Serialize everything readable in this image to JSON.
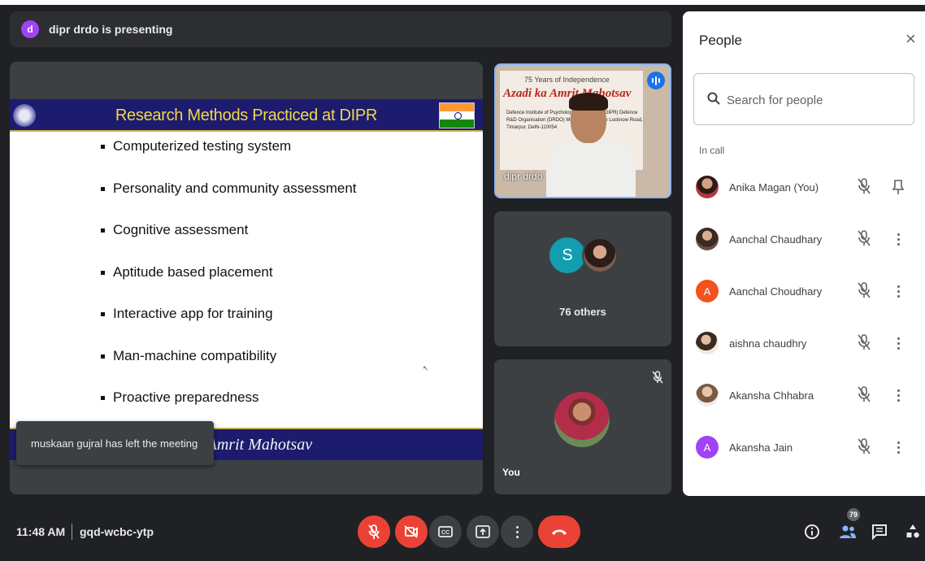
{
  "presenting": {
    "avatar_letter": "d",
    "text": "dipr drdo is presenting"
  },
  "slide": {
    "title": "Research Methods Practiced at DIPR",
    "bullets": [
      "Computerized testing system",
      "Personality and community assessment",
      "Cognitive assessment",
      "Aptitude based placement",
      "Interactive app for training",
      "Man-machine compatibility",
      "Proactive preparedness"
    ],
    "footer_text": "a Amrit Mahotsav"
  },
  "toast": {
    "text": "muskaan gujral has left the meeting"
  },
  "tiles": {
    "presenter": {
      "name": "dipr drdo",
      "banner_top": "75 Years of Independence",
      "banner_main": "Azadi ka Amrit Mahotsav",
      "banner_small": "Defence Institute of Psychological Research (DIPR) Defence R&D Organisation (DRDO) Ministry of Defence Lucknow Road, Timarpur, Delhi-110054"
    },
    "others": {
      "avatar_letter": "S",
      "label": "76 others"
    },
    "you": {
      "label": "You"
    }
  },
  "panel": {
    "title": "People",
    "search_placeholder": "Search for people",
    "section_label": "In call",
    "participants": [
      {
        "name": "Anika Magan (You)",
        "avatar": "photo",
        "color": "#b03848",
        "action": "pin"
      },
      {
        "name": "Aanchal Chaudhary",
        "avatar": "photo",
        "color": "#6d4c41",
        "action": "more"
      },
      {
        "name": "Aanchal Choudhary",
        "avatar": "A",
        "color": "#f4511e",
        "action": "more"
      },
      {
        "name": "aishna chaudhry",
        "avatar": "photo",
        "color": "#8d6e63",
        "action": "more"
      },
      {
        "name": "Akansha Chhabra",
        "avatar": "photo",
        "color": "#c8a28a",
        "action": "more"
      },
      {
        "name": "Akansha Jain",
        "avatar": "A",
        "color": "#a142f4",
        "action": "more"
      }
    ]
  },
  "bottom": {
    "time": "11:48 AM",
    "meeting_code": "gqd-wcbc-ytp",
    "people_count": "79"
  },
  "colors": {
    "accent": "#8ab4f8",
    "danger": "#ea4335",
    "surface": "#3c4043",
    "background": "#202124"
  }
}
